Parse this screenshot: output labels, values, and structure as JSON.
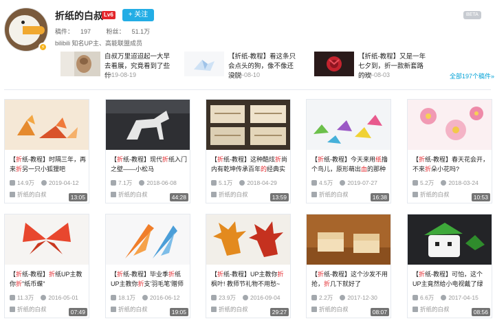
{
  "profile": {
    "name": "折纸的白叔",
    "level": "Lv6",
    "follow_label": "+ 关注",
    "beta_label": "BETA",
    "stats": {
      "works_label": "稿件：",
      "works": "197",
      "fans_label": "粉丝：",
      "fans": "51.1万"
    },
    "sign": "bilibili 知名UP主、高能联盟成员"
  },
  "recent": [
    {
      "title": "白叔万里迢迢起一大早去看展，究竟看到了些什",
      "date": "2019-08-19"
    },
    {
      "title": "【折纸-教程】看这条只会点头的狗，像不像还没脱",
      "date": "2019-08-10"
    },
    {
      "title": "【折纸-教程】又是一年七夕到，折一款新套路的玫",
      "date": "2019-08-03"
    }
  ],
  "all_videos_link": "全部197个稿件»",
  "videos": [
    {
      "title_parts": [
        "【",
        "折",
        "纸-教程】时隔三年，再来",
        "折",
        "另一只小狐狸吧"
      ],
      "duration": "13:05",
      "views": "14.9万",
      "date": "2019-04-12",
      "uploader": "折纸的白叔"
    },
    {
      "title_parts": [
        "【",
        "折",
        "纸-教程】现代",
        "折",
        "纸入门之壁——小松马"
      ],
      "duration": "44:28",
      "views": "7.1万",
      "date": "2018-06-08",
      "uploader": "折纸的白叔"
    },
    {
      "title_parts": [
        "【",
        "折",
        "纸-教程】这种酷炫",
        "折",
        "尚内有乾坤传承百年",
        "的",
        "经典实"
      ],
      "duration": "13:59",
      "views": "5.1万",
      "date": "2018-04-29",
      "uploader": "折纸的白叔"
    },
    {
      "title_parts": [
        "【",
        "折",
        "纸-教程】今天来用",
        "纸",
        "撸个鸟儿，原形萌出",
        "血",
        "的那种"
      ],
      "duration": "16:38",
      "views": "4.5万",
      "date": "2019-07-27",
      "uploader": "折纸的白叔"
    },
    {
      "title_parts": [
        "【",
        "折",
        "纸-教程】春天花会开，不来",
        "折",
        "朵小花吗?"
      ],
      "duration": "10:53",
      "views": "5.2万",
      "date": "2018-03-24",
      "uploader": "折纸的白叔"
    },
    {
      "title_parts": [
        "【",
        "折",
        "纸-教程】",
        "折",
        "纸UP主教你",
        "折",
        "\"纸币蝶\""
      ],
      "duration": "07:49",
      "views": "11.3万",
      "date": "2016-05-01",
      "uploader": "折纸的白叔"
    },
    {
      "title_parts": [
        "【",
        "折",
        "纸-教程】毕业季",
        "折",
        "纸UP主教你",
        "折",
        "支'羽毛笔'赠师"
      ],
      "duration": "19:05",
      "views": "18.1万",
      "date": "2016-06-12",
      "uploader": "折纸的白叔"
    },
    {
      "title_parts": [
        "【",
        "折",
        "纸-教程】UP主教你",
        "折",
        "枫叶! 教师节礼物不用愁~"
      ],
      "duration": "29:27",
      "views": "23.9万",
      "date": "2016-09-04",
      "uploader": "折纸的白叔"
    },
    {
      "title_parts": [
        "【",
        "折",
        "纸-教程】这个沙发不用抢，",
        "折",
        "几下就好了"
      ],
      "duration": "08:07",
      "views": "2.2万",
      "date": "2017-12-30",
      "uploader": "折纸的白叔"
    },
    {
      "title_parts": [
        "【",
        "折",
        "纸-教程】可怕，这个UP主竟然给小电视戴了绿"
      ],
      "duration": "08:56",
      "views": "6.6万",
      "date": "2017-04-15",
      "uploader": "折纸的白叔"
    }
  ]
}
